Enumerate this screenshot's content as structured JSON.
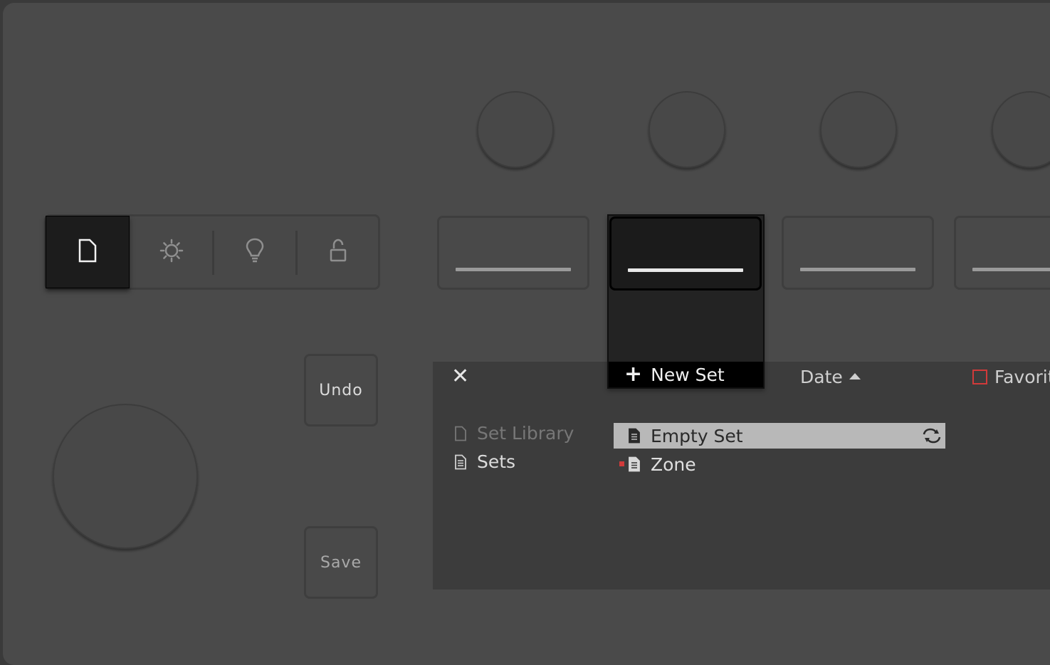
{
  "mode_bar": {
    "buttons": [
      {
        "name": "set",
        "icon": "document-icon",
        "active": true
      },
      {
        "name": "settings",
        "icon": "gear-icon",
        "active": false
      },
      {
        "name": "tips",
        "icon": "lightbulb-icon",
        "active": false
      },
      {
        "name": "lock",
        "icon": "lock-icon",
        "active": false
      }
    ]
  },
  "buttons": {
    "undo_label": "Undo",
    "save_label": "Save"
  },
  "popup": {
    "new_set_label": "New Set"
  },
  "browser": {
    "close_icon": "close-icon",
    "sort_label": "Date",
    "favorites_label": "Favorit",
    "locations": [
      {
        "label": "Set Library",
        "icon": "document-icon",
        "enabled": false
      },
      {
        "label": "Sets",
        "icon": "set-file-icon",
        "enabled": true
      }
    ],
    "files": [
      {
        "label": "Empty Set",
        "icon": "set-file-icon",
        "selected": true,
        "sync_icon": "sync-icon"
      },
      {
        "label": "Zone",
        "icon": "set-file-icon",
        "selected": false,
        "tag_color": "#d13a3a"
      }
    ]
  },
  "colors": {
    "device_bg": "#4a4a4a",
    "active_bg": "#1c1c1c",
    "selected_row": "#b8b8b8",
    "favorite_red": "#d13a3a"
  }
}
